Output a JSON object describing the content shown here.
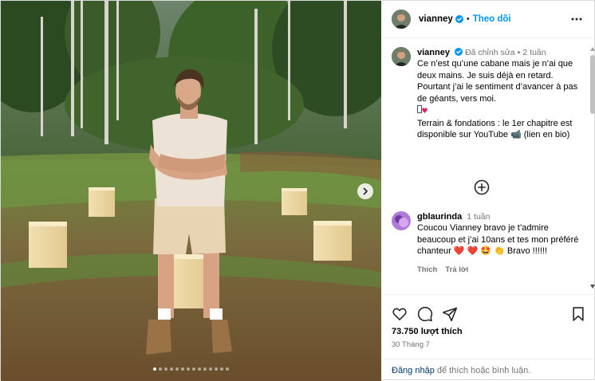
{
  "header": {
    "username": "vianney",
    "separator": "•",
    "follow_label": "Theo dõi"
  },
  "caption": {
    "username": "vianney",
    "edited_label": "Đã chỉnh sửa",
    "separator": "•",
    "time": "2 tuần",
    "text": "Ce n’est qu’une cabane mais je n’ai que deux mains. Je suis déjà en retard. Pourtant j’ai le sentiment d’avancer à pas de géants, vers moi.\n",
    "text2": "\nTerrain & fondations : le 1er chapitre est disponible sur YouTube 📹 (lien en bio)"
  },
  "comment": {
    "username": "gblaurinda",
    "time": "1 tuần",
    "text": "Coucou Vianney bravo je t’admire beaucoup et j’ai 10ans et tes mon préféré chanteur ❤️ ❤️ 🤩 👏 Bravo !!!!!!",
    "like_label": "Thích",
    "reply_label": "Trả lời"
  },
  "post": {
    "likes": "73.750 lượt thích",
    "date": "30 Tháng 7",
    "login_link": "Đăng nhập",
    "login_rest": " để thích hoặc bình luận."
  },
  "icons": {
    "more": "more-options-icon",
    "like": "heart-icon",
    "comment": "comment-icon",
    "share": "share-icon",
    "save": "bookmark-icon",
    "next": "chevron-right-icon",
    "load_more": "plus-circle-icon"
  },
  "colors": {
    "accent": "#0095f6",
    "verified": "#0095f6",
    "heart": "#e0245e"
  },
  "carousel": {
    "slide_count": 14,
    "active_index": 0
  }
}
